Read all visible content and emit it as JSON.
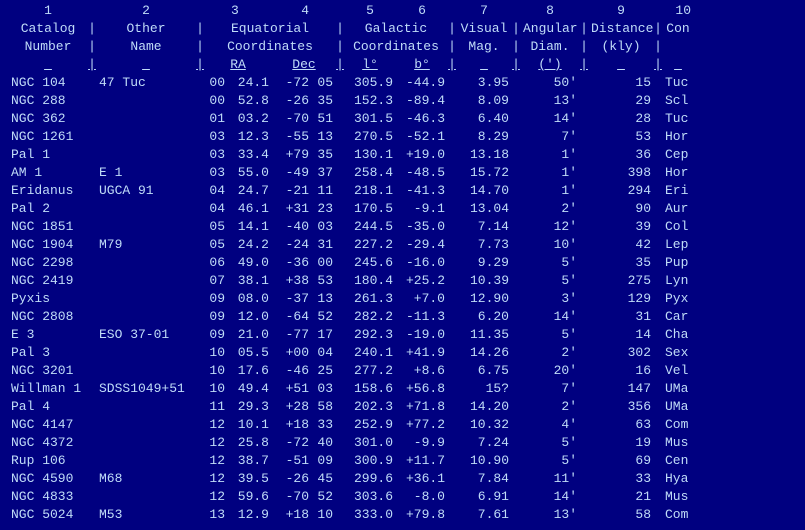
{
  "colnums": [
    "1",
    "2",
    "3",
    "4",
    "5",
    "6",
    "7",
    "8",
    "9",
    "10"
  ],
  "headers": {
    "line1": {
      "catalog": "Catalog",
      "other": "Other",
      "eq": "Equatorial",
      "gal": "Galactic",
      "vmag": "Visual",
      "adiam": "Angular",
      "dist": "Distance",
      "con": "Con"
    },
    "line2": {
      "catalog": "Number",
      "other": "Name",
      "eq": "Coordinates",
      "gal": "Coordinates",
      "vmag": "Mag.",
      "adiam": "Diam.",
      "dist": "(kly)",
      "con": ""
    },
    "line3": {
      "ra": "RA",
      "dec": "Dec",
      "l": "l°",
      "b": "b°",
      "adiam": "(')"
    }
  },
  "rows": [
    {
      "cat": "NGC 104",
      "other": "47 Tuc",
      "raH": "00",
      "raM": "24.1",
      "decD": "-72",
      "decM": "05",
      "l": "305.9",
      "b": "-44.9",
      "vmag": "3.95",
      "adiam": "50'",
      "dist": "15",
      "con": "Tuc"
    },
    {
      "cat": "NGC 288",
      "other": "",
      "raH": "00",
      "raM": "52.8",
      "decD": "-26",
      "decM": "35",
      "l": "152.3",
      "b": "-89.4",
      "vmag": "8.09",
      "adiam": "13'",
      "dist": "29",
      "con": "Scl"
    },
    {
      "cat": "NGC 362",
      "other": "",
      "raH": "01",
      "raM": "03.2",
      "decD": "-70",
      "decM": "51",
      "l": "301.5",
      "b": "-46.3",
      "vmag": "6.40",
      "adiam": "14'",
      "dist": "28",
      "con": "Tuc"
    },
    {
      "cat": "NGC 1261",
      "other": "",
      "raH": "03",
      "raM": "12.3",
      "decD": "-55",
      "decM": "13",
      "l": "270.5",
      "b": "-52.1",
      "vmag": "8.29",
      "adiam": "7'",
      "dist": "53",
      "con": "Hor"
    },
    {
      "cat": "Pal 1",
      "other": "",
      "raH": "03",
      "raM": "33.4",
      "decD": "+79",
      "decM": "35",
      "l": "130.1",
      "b": "+19.0",
      "vmag": "13.18",
      "adiam": "1'",
      "dist": "36",
      "con": "Cep"
    },
    {
      "cat": "AM 1",
      "other": "E 1",
      "raH": "03",
      "raM": "55.0",
      "decD": "-49",
      "decM": "37",
      "l": "258.4",
      "b": "-48.5",
      "vmag": "15.72",
      "adiam": "1'",
      "dist": "398",
      "con": "Hor"
    },
    {
      "cat": "Eridanus",
      "other": "UGCA 91",
      "raH": "04",
      "raM": "24.7",
      "decD": "-21",
      "decM": "11",
      "l": "218.1",
      "b": "-41.3",
      "vmag": "14.70",
      "adiam": "1'",
      "dist": "294",
      "con": "Eri"
    },
    {
      "cat": "Pal 2",
      "other": "",
      "raH": "04",
      "raM": "46.1",
      "decD": "+31",
      "decM": "23",
      "l": "170.5",
      "b": "-9.1",
      "vmag": "13.04",
      "adiam": "2'",
      "dist": "90",
      "con": "Aur"
    },
    {
      "cat": "NGC 1851",
      "other": "",
      "raH": "05",
      "raM": "14.1",
      "decD": "-40",
      "decM": "03",
      "l": "244.5",
      "b": "-35.0",
      "vmag": "7.14",
      "adiam": "12'",
      "dist": "39",
      "con": "Col"
    },
    {
      "cat": "NGC 1904",
      "other": "M79",
      "raH": "05",
      "raM": "24.2",
      "decD": "-24",
      "decM": "31",
      "l": "227.2",
      "b": "-29.4",
      "vmag": "7.73",
      "adiam": "10'",
      "dist": "42",
      "con": "Lep"
    },
    {
      "cat": "NGC 2298",
      "other": "",
      "raH": "06",
      "raM": "49.0",
      "decD": "-36",
      "decM": "00",
      "l": "245.6",
      "b": "-16.0",
      "vmag": "9.29",
      "adiam": "5'",
      "dist": "35",
      "con": "Pup"
    },
    {
      "cat": "NGC 2419",
      "other": "",
      "raH": "07",
      "raM": "38.1",
      "decD": "+38",
      "decM": "53",
      "l": "180.4",
      "b": "+25.2",
      "vmag": "10.39",
      "adiam": "5'",
      "dist": "275",
      "con": "Lyn"
    },
    {
      "cat": "Pyxis",
      "other": "",
      "raH": "09",
      "raM": "08.0",
      "decD": "-37",
      "decM": "13",
      "l": "261.3",
      "b": "+7.0",
      "vmag": "12.90",
      "adiam": "3'",
      "dist": "129",
      "con": "Pyx"
    },
    {
      "cat": "NGC 2808",
      "other": "",
      "raH": "09",
      "raM": "12.0",
      "decD": "-64",
      "decM": "52",
      "l": "282.2",
      "b": "-11.3",
      "vmag": "6.20",
      "adiam": "14'",
      "dist": "31",
      "con": "Car"
    },
    {
      "cat": "E 3",
      "other": "ESO 37-01",
      "raH": "09",
      "raM": "21.0",
      "decD": "-77",
      "decM": "17",
      "l": "292.3",
      "b": "-19.0",
      "vmag": "11.35",
      "adiam": "5'",
      "dist": "14",
      "con": "Cha"
    },
    {
      "cat": "Pal 3",
      "other": "",
      "raH": "10",
      "raM": "05.5",
      "decD": "+00",
      "decM": "04",
      "l": "240.1",
      "b": "+41.9",
      "vmag": "14.26",
      "adiam": "2'",
      "dist": "302",
      "con": "Sex"
    },
    {
      "cat": "NGC 3201",
      "other": "",
      "raH": "10",
      "raM": "17.6",
      "decD": "-46",
      "decM": "25",
      "l": "277.2",
      "b": "+8.6",
      "vmag": "6.75",
      "adiam": "20'",
      "dist": "16",
      "con": "Vel"
    },
    {
      "cat": "Willman 1",
      "other": "SDSS1049+51",
      "raH": "10",
      "raM": "49.4",
      "decD": "+51",
      "decM": "03",
      "l": "158.6",
      "b": "+56.8",
      "vmag": "15?",
      "adiam": "7'",
      "dist": "147",
      "con": "UMa"
    },
    {
      "cat": "Pal 4",
      "other": "",
      "raH": "11",
      "raM": "29.3",
      "decD": "+28",
      "decM": "58",
      "l": "202.3",
      "b": "+71.8",
      "vmag": "14.20",
      "adiam": "2'",
      "dist": "356",
      "con": "UMa"
    },
    {
      "cat": "NGC 4147",
      "other": "",
      "raH": "12",
      "raM": "10.1",
      "decD": "+18",
      "decM": "33",
      "l": "252.9",
      "b": "+77.2",
      "vmag": "10.32",
      "adiam": "4'",
      "dist": "63",
      "con": "Com"
    },
    {
      "cat": "NGC 4372",
      "other": "",
      "raH": "12",
      "raM": "25.8",
      "decD": "-72",
      "decM": "40",
      "l": "301.0",
      "b": "-9.9",
      "vmag": "7.24",
      "adiam": "5'",
      "dist": "19",
      "con": "Mus"
    },
    {
      "cat": "Rup 106",
      "other": "",
      "raH": "12",
      "raM": "38.7",
      "decD": "-51",
      "decM": "09",
      "l": "300.9",
      "b": "+11.7",
      "vmag": "10.90",
      "adiam": "5'",
      "dist": "69",
      "con": "Cen"
    },
    {
      "cat": "NGC 4590",
      "other": "M68",
      "raH": "12",
      "raM": "39.5",
      "decD": "-26",
      "decM": "45",
      "l": "299.6",
      "b": "+36.1",
      "vmag": "7.84",
      "adiam": "11'",
      "dist": "33",
      "con": "Hya"
    },
    {
      "cat": "NGC 4833",
      "other": "",
      "raH": "12",
      "raM": "59.6",
      "decD": "-70",
      "decM": "52",
      "l": "303.6",
      "b": "-8.0",
      "vmag": "6.91",
      "adiam": "14'",
      "dist": "21",
      "con": "Mus"
    },
    {
      "cat": "NGC 5024",
      "other": "M53",
      "raH": "13",
      "raM": "12.9",
      "decD": "+18",
      "decM": "10",
      "l": "333.0",
      "b": "+79.8",
      "vmag": "7.61",
      "adiam": "13'",
      "dist": "58",
      "con": "Com"
    }
  ]
}
